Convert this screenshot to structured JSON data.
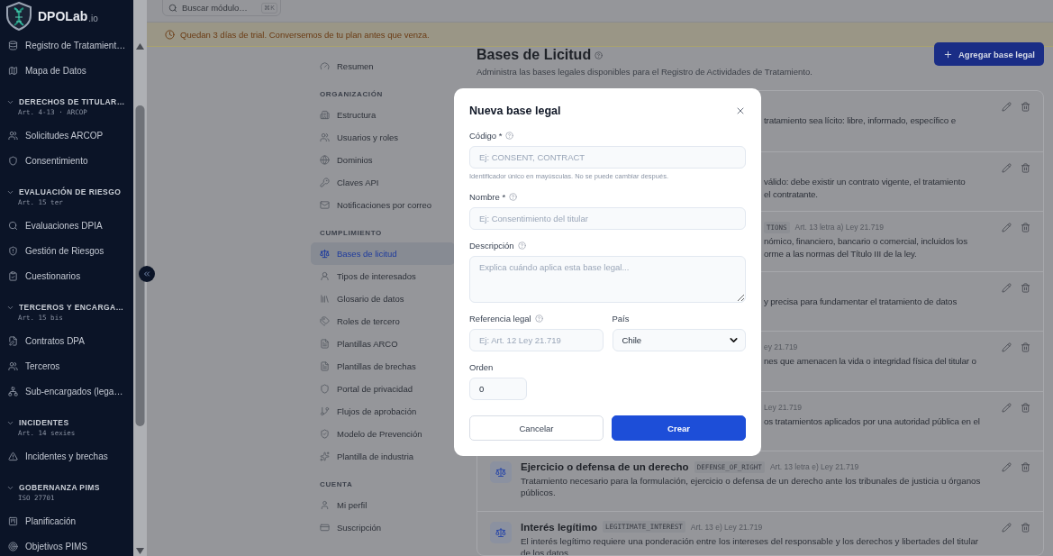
{
  "sidebar": {
    "logo": {
      "name": "DPOLab",
      "suffix": ".io"
    },
    "sections": [
      {
        "items": [
          {
            "label": "Registro de Tratamient…"
          },
          {
            "label": "Mapa de Datos"
          }
        ]
      },
      {
        "title": "DERECHOS DE TITULAR…",
        "subtitle": "Art. 4-13 · ARCOP",
        "expanded": true,
        "items": [
          {
            "label": "Solicitudes ARCOP"
          },
          {
            "label": "Consentimiento"
          }
        ]
      },
      {
        "title": "EVALUACIÓN DE RIESGO",
        "subtitle": "Art. 15 ter",
        "expanded": true,
        "items": [
          {
            "label": "Evaluaciones DPIA"
          },
          {
            "label": "Gestión de Riesgos"
          },
          {
            "label": "Cuestionarios"
          }
        ]
      },
      {
        "title": "TERCEROS Y ENCARGA…",
        "subtitle": "Art. 15 bis",
        "expanded": true,
        "items": [
          {
            "label": "Contratos DPA"
          },
          {
            "label": "Terceros"
          },
          {
            "label": "Sub-encargados (lega…"
          }
        ]
      },
      {
        "title": "INCIDENTES",
        "subtitle": "Art. 14 sexies",
        "expanded": true,
        "items": [
          {
            "label": "Incidentes y brechas"
          }
        ]
      },
      {
        "title": "GOBERNANZA PIMS",
        "subtitle": "ISO 27701",
        "expanded": true,
        "items": [
          {
            "label": "Planificación"
          },
          {
            "label": "Objetivos PIMS"
          }
        ]
      }
    ]
  },
  "top_bar": {
    "search": {
      "placeholder": "Buscar módulo…",
      "shortcut": "⌘K"
    }
  },
  "banner": {
    "text": "Quedan 3 días de trial. Conversemos de tu plan antes que venza."
  },
  "settings_nav": [
    {
      "items": [
        {
          "label": "Resumen",
          "selected": false
        }
      ]
    },
    {
      "title": "ORGANIZACIÓN",
      "items": [
        {
          "label": "Estructura",
          "selected": false
        },
        {
          "label": "Usuarios y roles",
          "selected": false
        },
        {
          "label": "Dominios",
          "selected": false
        },
        {
          "label": "Claves API",
          "selected": false
        },
        {
          "label": "Notificaciones por correo",
          "selected": false
        }
      ]
    },
    {
      "title": "CUMPLIMIENTO",
      "items": [
        {
          "label": "Bases de licitud",
          "selected": true
        },
        {
          "label": "Tipos de interesados",
          "selected": false
        },
        {
          "label": "Glosario de datos",
          "selected": false
        },
        {
          "label": "Roles de tercero",
          "selected": false
        },
        {
          "label": "Plantillas ARCO",
          "selected": false
        },
        {
          "label": "Plantillas de brechas",
          "selected": false
        },
        {
          "label": "Portal de privacidad",
          "selected": false
        },
        {
          "label": "Flujos de aprobación",
          "selected": false
        },
        {
          "label": "Modelo de Prevención",
          "selected": false
        },
        {
          "label": "Plantilla de industria",
          "selected": false
        }
      ]
    },
    {
      "title": "CUENTA",
      "items": [
        {
          "label": "Mi perfil",
          "selected": false
        },
        {
          "label": "Suscripción",
          "selected": false
        }
      ]
    }
  ],
  "page": {
    "title": "Bases de Licitud",
    "subtitle": "Administra las bases legales disponibles para el Registro de Actividades de Tratamiento.",
    "add_button": "Agregar base legal"
  },
  "legal_bases": [
    {
      "kind": "covered",
      "lines": [
        "tratamiento sea lícito: libre, informado, específico e"
      ]
    },
    {
      "kind": "covered",
      "lines": [
        "válido: debe existir un contrato vigente, el tratamiento",
        "el contratante."
      ]
    },
    {
      "kind": "covered",
      "code": "TIONS",
      "reference": "Art. 13 letra a) Ley 21.719",
      "lines": [
        "nómico, financiero, bancario o comercial, incluidos los",
        "orme a las normas del Título III de la ley."
      ]
    },
    {
      "kind": "covered",
      "lines": [
        "y precisa para fundamentar el tratamiento de datos"
      ]
    },
    {
      "kind": "covered",
      "reference": "ey 21.719",
      "lines": [
        "nes que amenacen la vida o integridad física del titular o"
      ]
    },
    {
      "kind": "covered",
      "reference": "Ley 21.719",
      "lines": [
        "os tratamientos aplicados por una autoridad pública en el"
      ]
    },
    {
      "kind": "full",
      "title": "Ejercicio o defensa de un derecho",
      "code": "DEFENSE_OF_RIGHT",
      "reference": "Art. 13 letra e) Ley 21.719",
      "description": "Tratamiento necesario para la formulación, ejercicio o defensa de un derecho ante los tribunales de justicia u órganos públicos."
    },
    {
      "kind": "full",
      "title": "Interés legítimo",
      "code": "LEGITIMATE_INTEREST",
      "reference": "Art. 13 e) Ley 21.719",
      "description": "El interés legítimo requiere una ponderación entre los intereses del responsable y los derechos y libertades del titular de los datos."
    }
  ],
  "modal": {
    "title": "Nueva base legal",
    "rows": [
      {
        "fields": [
          {
            "kind": "text",
            "label": "Código *",
            "help": true,
            "placeholder": "Ej: CONSENT, CONTRACT",
            "hint": "Identificador único en mayúsculas. No se puede cambiar después."
          }
        ]
      },
      {
        "fields": [
          {
            "kind": "text",
            "label": "Nombre *",
            "help": true,
            "placeholder": "Ej: Consentimiento del titular"
          }
        ]
      },
      {
        "fields": [
          {
            "kind": "textarea",
            "label": "Descripción",
            "help": true,
            "placeholder": "Explica cuándo aplica esta base legal..."
          }
        ]
      },
      {
        "fields": [
          {
            "kind": "text",
            "label": "Referencia legal",
            "help": true,
            "placeholder": "Ej: Art. 12 Ley 21.719"
          },
          {
            "kind": "select",
            "label": "País",
            "help": false,
            "value": "Chile"
          }
        ]
      },
      {
        "fields": [
          {
            "kind": "number",
            "label": "Orden",
            "help": false,
            "value": "0"
          }
        ]
      }
    ],
    "buttons": [
      {
        "label": "Cancelar",
        "kind": "secondary"
      },
      {
        "label": "Crear",
        "kind": "primary"
      }
    ]
  }
}
